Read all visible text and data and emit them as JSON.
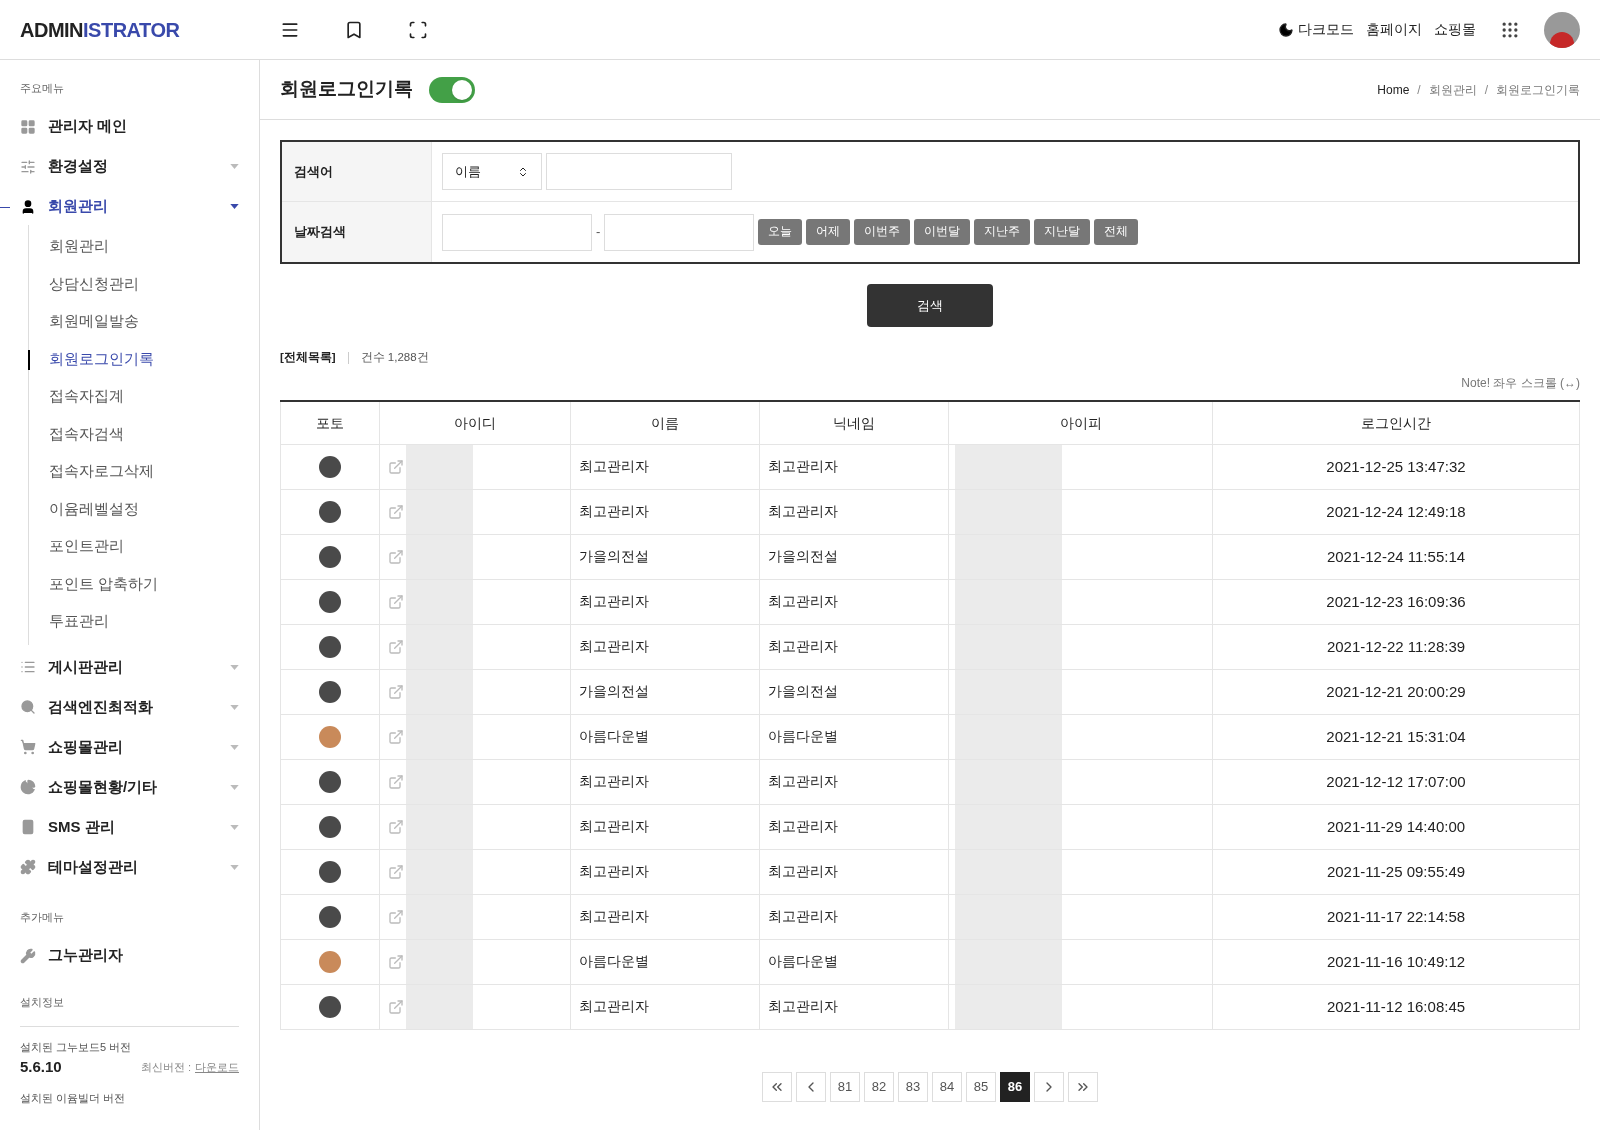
{
  "header": {
    "logo_dark": "ADMIN",
    "logo_accent": "ISTRATOR",
    "links": [
      {
        "label": "다크모드"
      },
      {
        "label": "홈페이지"
      },
      {
        "label": "쇼핑몰"
      }
    ]
  },
  "sidebar": {
    "sections": [
      {
        "title": "주요메뉴",
        "items": [
          {
            "label": "관리자 메인",
            "selected": false
          },
          {
            "label": "환경설정",
            "selected": false,
            "expanded": false
          },
          {
            "label": "회원관리",
            "selected": true,
            "expanded": true,
            "children": [
              {
                "label": "회원관리",
                "selected": false
              },
              {
                "label": "상담신청관리",
                "selected": false
              },
              {
                "label": "회원메일발송",
                "selected": false
              },
              {
                "label": "회원로그인기록",
                "selected": true
              },
              {
                "label": "접속자집계",
                "selected": false
              },
              {
                "label": "접속자검색",
                "selected": false
              },
              {
                "label": "접속자로그삭제",
                "selected": false
              },
              {
                "label": "이윰레벨설정",
                "selected": false
              },
              {
                "label": "포인트관리",
                "selected": false
              },
              {
                "label": "포인트 압축하기",
                "selected": false
              },
              {
                "label": "투표관리",
                "selected": false
              }
            ]
          },
          {
            "label": "게시판관리",
            "selected": false,
            "expanded": false
          },
          {
            "label": "검색엔진최적화",
            "selected": false,
            "expanded": false
          },
          {
            "label": "쇼핑몰관리",
            "selected": false,
            "expanded": false
          },
          {
            "label": "쇼핑몰현황/기타",
            "selected": false,
            "expanded": false
          },
          {
            "label": "SMS 관리",
            "selected": false,
            "expanded": false
          },
          {
            "label": "테마설정관리",
            "selected": false,
            "expanded": false
          }
        ]
      },
      {
        "title": "추가메뉴",
        "items": [
          {
            "label": "그누관리자",
            "selected": false
          }
        ]
      }
    ],
    "install": {
      "title": "설치정보",
      "gnuboard_label": "설치된 그누보드5 버전",
      "gnuboard_version": "5.6.10",
      "latest_label": "최신버전 :",
      "download_link": "다운로드",
      "eyoom_label": "설치된 이윰빌더 버전"
    }
  },
  "page": {
    "title": "회원로그인기록",
    "toggle": {
      "on": true
    },
    "breadcrumb": {
      "items": [
        "Home",
        "회원관리",
        "회원로그인기록"
      ],
      "separator": "/"
    }
  },
  "search": {
    "keyword_label": "검색어",
    "field_select": "이름",
    "date_label": "날짜검색",
    "date_separator": "-",
    "date_buttons": [
      "오늘",
      "어제",
      "이번주",
      "이번달",
      "지난주",
      "지난달",
      "전체"
    ],
    "submit": "검색"
  },
  "summary": {
    "list_label": "[전체목록]",
    "count": "건수 1,288건",
    "note": "Note! 좌우 스크롤 (↔)"
  },
  "table": {
    "columns": [
      "포토",
      "아이디",
      "이름",
      "닉네임",
      "아이피",
      "로그인시간"
    ],
    "rows": [
      {
        "color": "#4a4a4a",
        "name": "최고관리자",
        "nickname": "최고관리자",
        "time": "2021-12-25 13:47:32"
      },
      {
        "color": "#4a4a4a",
        "name": "최고관리자",
        "nickname": "최고관리자",
        "time": "2021-12-24 12:49:18"
      },
      {
        "color": "#4a4a4a",
        "name": "가을의전설",
        "nickname": "가을의전설",
        "time": "2021-12-24 11:55:14"
      },
      {
        "color": "#4a4a4a",
        "name": "최고관리자",
        "nickname": "최고관리자",
        "time": "2021-12-23 16:09:36"
      },
      {
        "color": "#4a4a4a",
        "name": "최고관리자",
        "nickname": "최고관리자",
        "time": "2021-12-22 11:28:39"
      },
      {
        "color": "#4a4a4a",
        "name": "가을의전설",
        "nickname": "가을의전설",
        "time": "2021-12-21 20:00:29"
      },
      {
        "color": "#c98a5a",
        "name": "아름다운별",
        "nickname": "아름다운별",
        "time": "2021-12-21 15:31:04"
      },
      {
        "color": "#4a4a4a",
        "name": "최고관리자",
        "nickname": "최고관리자",
        "time": "2021-12-12 17:07:00"
      },
      {
        "color": "#4a4a4a",
        "name": "최고관리자",
        "nickname": "최고관리자",
        "time": "2021-11-29 14:40:00"
      },
      {
        "color": "#4a4a4a",
        "name": "최고관리자",
        "nickname": "최고관리자",
        "time": "2021-11-25 09:55:49"
      },
      {
        "color": "#4a4a4a",
        "name": "최고관리자",
        "nickname": "최고관리자",
        "time": "2021-11-17 22:14:58"
      },
      {
        "color": "#c98a5a",
        "name": "아름다운별",
        "nickname": "아름다운별",
        "time": "2021-11-16 10:49:12"
      },
      {
        "color": "#4a4a4a",
        "name": "최고관리자",
        "nickname": "최고관리자",
        "time": "2021-11-12 16:08:45"
      }
    ]
  },
  "pagination": {
    "pages": [
      {
        "label": "81",
        "selected": false
      },
      {
        "label": "82",
        "selected": false
      },
      {
        "label": "83",
        "selected": false
      },
      {
        "label": "84",
        "selected": false
      },
      {
        "label": "85",
        "selected": false
      },
      {
        "label": "86",
        "selected": true
      }
    ]
  }
}
